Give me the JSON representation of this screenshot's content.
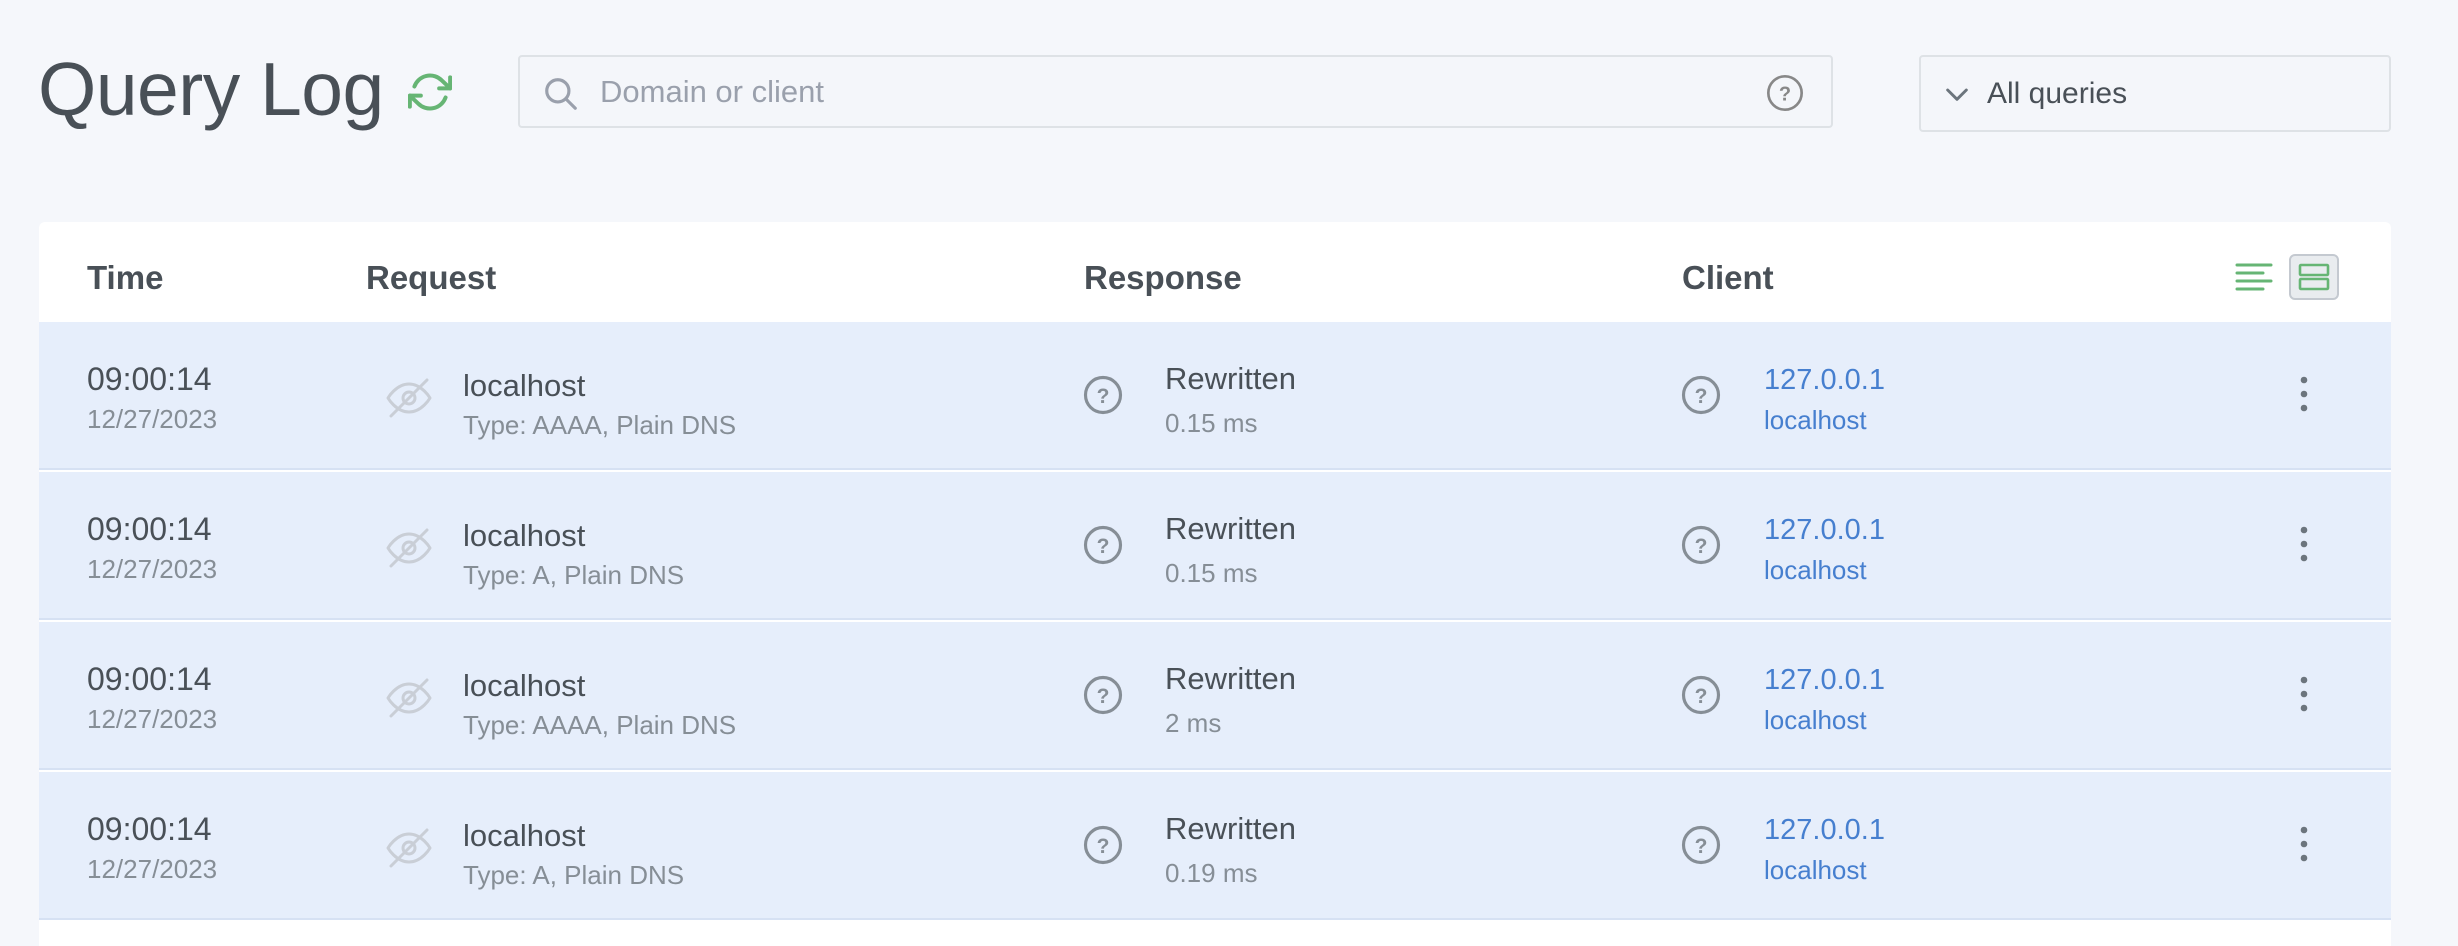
{
  "header": {
    "title": "Query Log",
    "search_placeholder": "Domain or client",
    "filter_selected": "All queries"
  },
  "table": {
    "columns": {
      "time": "Time",
      "request": "Request",
      "response": "Response",
      "client": "Client"
    },
    "rows": [
      {
        "time": "09:00:14",
        "date": "12/27/2023",
        "domain": "localhost",
        "type": "Type: AAAA, Plain DNS",
        "status": "Rewritten",
        "elapsed": "0.15 ms",
        "client_ip": "127.0.0.1",
        "client_name": "localhost"
      },
      {
        "time": "09:00:14",
        "date": "12/27/2023",
        "domain": "localhost",
        "type": "Type: A, Plain DNS",
        "status": "Rewritten",
        "elapsed": "0.15 ms",
        "client_ip": "127.0.0.1",
        "client_name": "localhost"
      },
      {
        "time": "09:00:14",
        "date": "12/27/2023",
        "domain": "localhost",
        "type": "Type: AAAA, Plain DNS",
        "status": "Rewritten",
        "elapsed": "2 ms",
        "client_ip": "127.0.0.1",
        "client_name": "localhost"
      },
      {
        "time": "09:00:14",
        "date": "12/27/2023",
        "domain": "localhost",
        "type": "Type: A, Plain DNS",
        "status": "Rewritten",
        "elapsed": "0.19 ms",
        "client_ip": "127.0.0.1",
        "client_name": "localhost"
      }
    ]
  },
  "icons": {
    "refresh": "refresh-icon",
    "search": "search-icon",
    "help": "help-circle-icon",
    "chevron": "chevron-down-icon",
    "compact_view": "compact-view-icon",
    "default_view": "default-view-icon",
    "hidden": "eye-off-icon",
    "menu": "more-vertical-icon"
  },
  "colors": {
    "background": "#f5f7fb",
    "row_background": "#e6eefb",
    "link": "#467fcf",
    "accent_green": "#66b574",
    "text": "#495057",
    "muted": "#868e96"
  }
}
